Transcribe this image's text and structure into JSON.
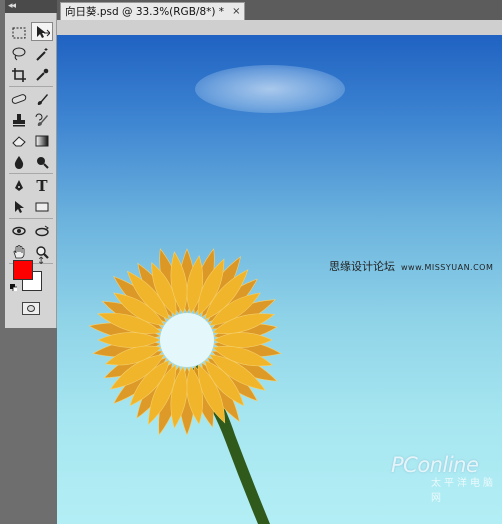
{
  "toolbox": {
    "collapse_icon": "double-chevron-left",
    "tools": [
      "marquee-icon",
      "move-icon",
      "lasso-icon",
      "magic-wand-icon",
      "crop-icon",
      "eyedropper-icon",
      "healing-icon",
      "brush-icon",
      "stamp-icon",
      "history-brush-icon",
      "eraser-icon",
      "gradient-icon",
      "blur-icon",
      "dodge-icon",
      "pen-icon",
      "type-icon",
      "path-select-icon",
      "shape-icon",
      "3d-rotate-icon",
      "3d-orbit-icon",
      "hand-icon",
      "zoom-icon"
    ],
    "foreground_color": "#ff0000",
    "background_color": "#ffffff",
    "type_glyph": "T"
  },
  "document": {
    "tab_title": "向日葵.psd @ 33.3%(RGB/8*) *",
    "close_glyph": "×"
  },
  "canvas": {
    "sky_top_color": "#1f62c2",
    "sky_bottom_color": "#b3eef5",
    "petal_color": "#f0b52a",
    "petal_dark_color": "#e0961c",
    "stem_color": "#2f5a1c",
    "watermark_cn": "思缘设计论坛",
    "watermark_url": "www.MISSYUAN.COM",
    "logo_text": "PConline",
    "logo_sub": "太平洋电脑网"
  }
}
